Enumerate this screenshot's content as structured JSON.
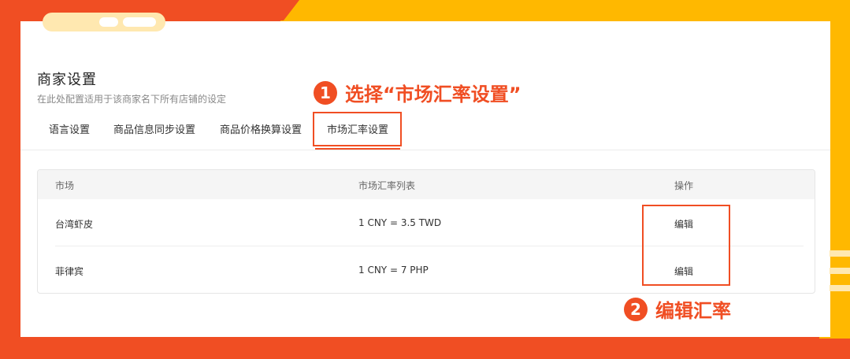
{
  "header": {
    "title": "商家设置",
    "subtitle": "在此处配置适用于该商家名下所有店铺的设定"
  },
  "tabs": [
    {
      "label": "语言设置",
      "active": false
    },
    {
      "label": "商品信息同步设置",
      "active": false
    },
    {
      "label": "商品价格换算设置",
      "active": false
    },
    {
      "label": "市场汇率设置",
      "active": true
    }
  ],
  "table": {
    "columns": [
      "市场",
      "市场汇率列表",
      "操作"
    ],
    "rows": [
      {
        "market": "台湾虾皮",
        "rate": "1 CNY = 3.5 TWD",
        "action": "编辑"
      },
      {
        "market": "菲律宾",
        "rate": "1 CNY = 7 PHP",
        "action": "编辑"
      }
    ]
  },
  "annotations": [
    {
      "number": "1",
      "text": "选择“市场汇率设置”"
    },
    {
      "number": "2",
      "text": "编辑汇率"
    }
  ],
  "colors": {
    "accent_red": "#f04e23",
    "frame_yellow": "#ffb800",
    "link_blue": "#3b82f6"
  }
}
